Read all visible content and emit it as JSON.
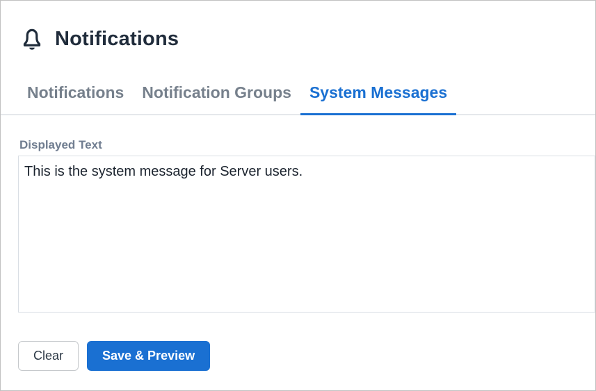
{
  "header": {
    "title": "Notifications",
    "icon": "bell"
  },
  "tabs": {
    "items": [
      {
        "label": "Notifications",
        "active": false
      },
      {
        "label": "Notification Groups",
        "active": false
      },
      {
        "label": "System Messages",
        "active": true
      }
    ],
    "active_label": "System Messages"
  },
  "form": {
    "displayed_text_label": "Displayed Text",
    "displayed_text_value": "This is the system message for Server users."
  },
  "actions": {
    "clear": "Clear",
    "save_preview": "Save & Preview"
  },
  "colors": {
    "accent_blue": "#1a70d2",
    "heading_text": "#202c3b",
    "inactive_tab_text": "#76808c",
    "label_text": "#707d90",
    "frame_border": "#c1c1c1",
    "field_border": "#d9dee4",
    "tabline": "#e5e8eb"
  }
}
